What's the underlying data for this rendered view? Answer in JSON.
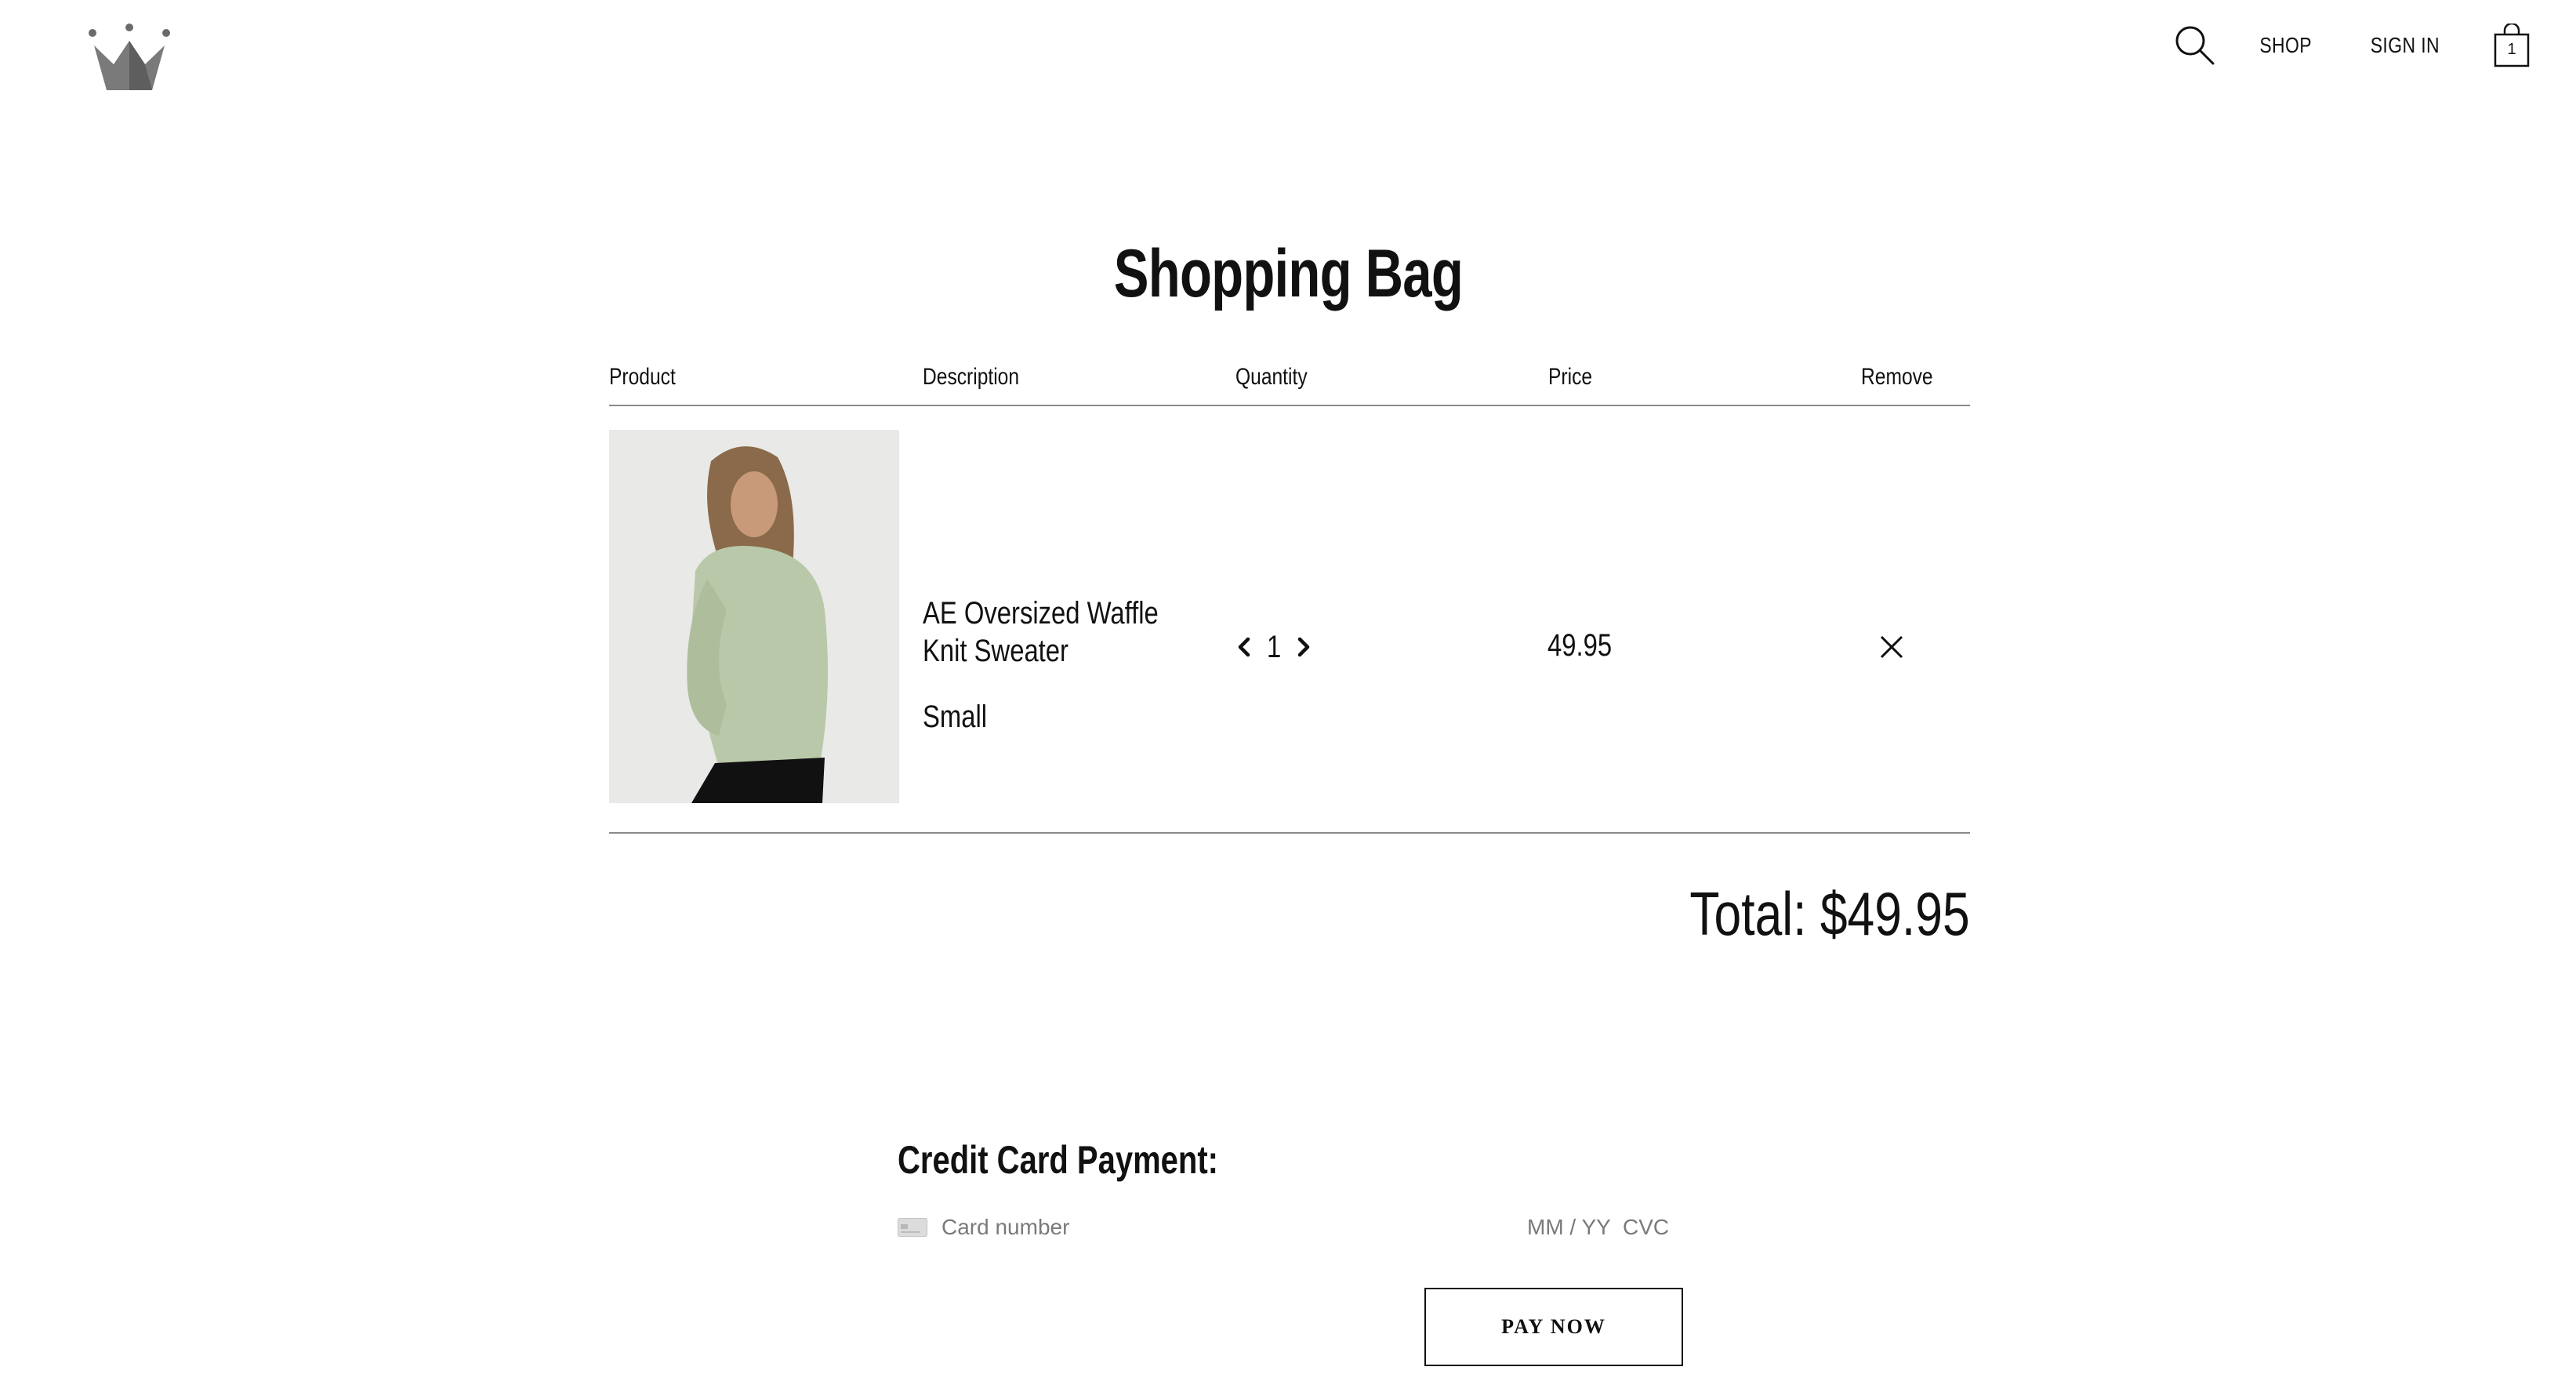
{
  "header": {
    "logo": "crown-logo",
    "nav": {
      "shop_label": "SHOP",
      "signin_label": "SIGN IN",
      "bag_count": "1"
    }
  },
  "page": {
    "title": "Shopping Bag"
  },
  "table": {
    "columns": [
      "Product",
      "Description",
      "Quantity",
      "Price",
      "Remove"
    ],
    "items": [
      {
        "image": "product-photo-sweater",
        "name": "AE Oversized Waffle Knit Sweater",
        "size": "Small",
        "quantity": "1",
        "price": "49.95"
      }
    ]
  },
  "summary": {
    "total": "Total: $49.95"
  },
  "payment": {
    "heading": "Credit Card Payment:",
    "card_number_placeholder": "Card number",
    "expiry_placeholder": "MM / YY",
    "cvc_placeholder": "CVC",
    "pay_button": "PAY NOW"
  },
  "colors": {
    "text": "#111111",
    "muted": "#7a7a7a",
    "divider": "#8a8a8a",
    "logo": "#6b6b6b",
    "sweater": "#b9c8a8"
  }
}
